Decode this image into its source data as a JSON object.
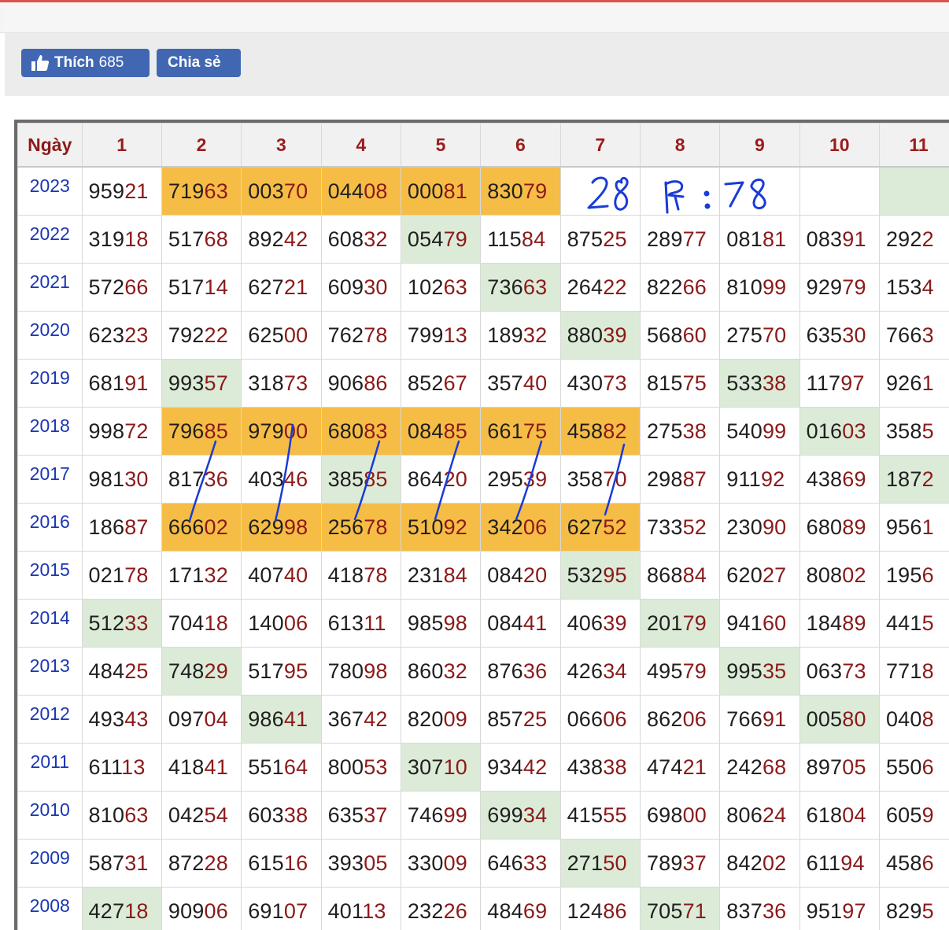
{
  "share": {
    "like_label": "Thích",
    "like_count": "685",
    "share_label": "Chia sẻ",
    "like_icon": "thumbs-up-icon"
  },
  "table": {
    "columns": [
      "Ngày",
      "1",
      "2",
      "3",
      "4",
      "5",
      "6",
      "7",
      "8",
      "9",
      "10",
      "11"
    ],
    "rows": [
      {
        "year": "2023",
        "cells": [
          [
            "959",
            "21",
            ""
          ],
          [
            "719",
            "63",
            "o"
          ],
          [
            "003",
            "70",
            "o"
          ],
          [
            "044",
            "08",
            "o"
          ],
          [
            "000",
            "81",
            "o"
          ],
          [
            "830",
            "79",
            "o"
          ],
          [
            "",
            "",
            ""
          ],
          [
            "",
            "",
            ""
          ],
          [
            "",
            "",
            ""
          ],
          [
            "",
            "",
            ""
          ],
          [
            "",
            "",
            "g"
          ]
        ]
      },
      {
        "year": "2022",
        "cells": [
          [
            "319",
            "18",
            ""
          ],
          [
            "517",
            "68",
            ""
          ],
          [
            "892",
            "42",
            ""
          ],
          [
            "608",
            "32",
            ""
          ],
          [
            "054",
            "79",
            "g"
          ],
          [
            "115",
            "84",
            ""
          ],
          [
            "875",
            "25",
            ""
          ],
          [
            "289",
            "77",
            ""
          ],
          [
            "081",
            "81",
            ""
          ],
          [
            "083",
            "91",
            ""
          ],
          [
            "292",
            "2",
            ""
          ]
        ]
      },
      {
        "year": "2021",
        "cells": [
          [
            "572",
            "66",
            ""
          ],
          [
            "517",
            "14",
            ""
          ],
          [
            "627",
            "21",
            ""
          ],
          [
            "609",
            "30",
            ""
          ],
          [
            "102",
            "63",
            ""
          ],
          [
            "736",
            "63",
            "g"
          ],
          [
            "264",
            "22",
            ""
          ],
          [
            "822",
            "66",
            ""
          ],
          [
            "810",
            "99",
            ""
          ],
          [
            "929",
            "79",
            ""
          ],
          [
            "153",
            "4",
            ""
          ]
        ]
      },
      {
        "year": "2020",
        "cells": [
          [
            "623",
            "23",
            ""
          ],
          [
            "792",
            "22",
            ""
          ],
          [
            "625",
            "00",
            ""
          ],
          [
            "762",
            "78",
            ""
          ],
          [
            "799",
            "13",
            ""
          ],
          [
            "189",
            "32",
            ""
          ],
          [
            "880",
            "39",
            "g"
          ],
          [
            "568",
            "60",
            ""
          ],
          [
            "275",
            "70",
            ""
          ],
          [
            "635",
            "30",
            ""
          ],
          [
            "766",
            "3",
            ""
          ]
        ]
      },
      {
        "year": "2019",
        "cells": [
          [
            "681",
            "91",
            ""
          ],
          [
            "993",
            "57",
            "g"
          ],
          [
            "318",
            "73",
            ""
          ],
          [
            "906",
            "86",
            ""
          ],
          [
            "852",
            "67",
            ""
          ],
          [
            "357",
            "40",
            ""
          ],
          [
            "430",
            "73",
            ""
          ],
          [
            "815",
            "75",
            ""
          ],
          [
            "533",
            "38",
            "g"
          ],
          [
            "117",
            "97",
            ""
          ],
          [
            "926",
            "1",
            ""
          ]
        ]
      },
      {
        "year": "2018",
        "cells": [
          [
            "998",
            "72",
            ""
          ],
          [
            "796",
            "85",
            "o"
          ],
          [
            "979",
            "00",
            "o"
          ],
          [
            "680",
            "83",
            "o"
          ],
          [
            "084",
            "85",
            "o"
          ],
          [
            "661",
            "75",
            "o"
          ],
          [
            "458",
            "82",
            "o"
          ],
          [
            "275",
            "38",
            ""
          ],
          [
            "540",
            "99",
            ""
          ],
          [
            "016",
            "03",
            "g"
          ],
          [
            "358",
            "5",
            ""
          ]
        ]
      },
      {
        "year": "2017",
        "cells": [
          [
            "981",
            "30",
            ""
          ],
          [
            "817",
            "36",
            ""
          ],
          [
            "403",
            "46",
            ""
          ],
          [
            "385",
            "85",
            "g"
          ],
          [
            "864",
            "20",
            ""
          ],
          [
            "295",
            "39",
            ""
          ],
          [
            "358",
            "70",
            ""
          ],
          [
            "298",
            "87",
            ""
          ],
          [
            "911",
            "92",
            ""
          ],
          [
            "438",
            "69",
            ""
          ],
          [
            "187",
            "2",
            "g"
          ]
        ]
      },
      {
        "year": "2016",
        "cells": [
          [
            "186",
            "87",
            ""
          ],
          [
            "666",
            "02",
            "o"
          ],
          [
            "629",
            "98",
            "o"
          ],
          [
            "256",
            "78",
            "o"
          ],
          [
            "510",
            "92",
            "o"
          ],
          [
            "342",
            "06",
            "o"
          ],
          [
            "627",
            "52",
            "o"
          ],
          [
            "733",
            "52",
            ""
          ],
          [
            "230",
            "90",
            ""
          ],
          [
            "680",
            "89",
            ""
          ],
          [
            "956",
            "1",
            ""
          ]
        ]
      },
      {
        "year": "2015",
        "cells": [
          [
            "021",
            "78",
            ""
          ],
          [
            "171",
            "32",
            ""
          ],
          [
            "407",
            "40",
            ""
          ],
          [
            "418",
            "78",
            ""
          ],
          [
            "231",
            "84",
            ""
          ],
          [
            "084",
            "20",
            ""
          ],
          [
            "532",
            "95",
            "g"
          ],
          [
            "868",
            "84",
            ""
          ],
          [
            "620",
            "27",
            ""
          ],
          [
            "808",
            "02",
            ""
          ],
          [
            "195",
            "6",
            ""
          ]
        ]
      },
      {
        "year": "2014",
        "cells": [
          [
            "512",
            "33",
            "g"
          ],
          [
            "704",
            "18",
            ""
          ],
          [
            "140",
            "06",
            ""
          ],
          [
            "613",
            "11",
            ""
          ],
          [
            "985",
            "98",
            ""
          ],
          [
            "084",
            "41",
            ""
          ],
          [
            "406",
            "39",
            ""
          ],
          [
            "201",
            "79",
            "g"
          ],
          [
            "941",
            "60",
            ""
          ],
          [
            "184",
            "89",
            ""
          ],
          [
            "441",
            "5",
            ""
          ]
        ]
      },
      {
        "year": "2013",
        "cells": [
          [
            "484",
            "25",
            ""
          ],
          [
            "748",
            "29",
            "g"
          ],
          [
            "517",
            "95",
            ""
          ],
          [
            "780",
            "98",
            ""
          ],
          [
            "860",
            "32",
            ""
          ],
          [
            "876",
            "36",
            ""
          ],
          [
            "426",
            "34",
            ""
          ],
          [
            "495",
            "79",
            ""
          ],
          [
            "995",
            "35",
            "g"
          ],
          [
            "063",
            "73",
            ""
          ],
          [
            "771",
            "8",
            ""
          ]
        ]
      },
      {
        "year": "2012",
        "cells": [
          [
            "493",
            "43",
            ""
          ],
          [
            "097",
            "04",
            ""
          ],
          [
            "986",
            "41",
            "g"
          ],
          [
            "367",
            "42",
            ""
          ],
          [
            "820",
            "09",
            ""
          ],
          [
            "857",
            "25",
            ""
          ],
          [
            "066",
            "06",
            ""
          ],
          [
            "862",
            "06",
            ""
          ],
          [
            "766",
            "91",
            ""
          ],
          [
            "005",
            "80",
            "g"
          ],
          [
            "040",
            "8",
            ""
          ]
        ]
      },
      {
        "year": "2011",
        "cells": [
          [
            "611",
            "13",
            ""
          ],
          [
            "418",
            "41",
            ""
          ],
          [
            "551",
            "64",
            ""
          ],
          [
            "800",
            "53",
            ""
          ],
          [
            "307",
            "10",
            "g"
          ],
          [
            "934",
            "42",
            ""
          ],
          [
            "438",
            "38",
            ""
          ],
          [
            "474",
            "21",
            ""
          ],
          [
            "242",
            "68",
            ""
          ],
          [
            "897",
            "05",
            ""
          ],
          [
            "550",
            "6",
            ""
          ]
        ]
      },
      {
        "year": "2010",
        "cells": [
          [
            "810",
            "63",
            ""
          ],
          [
            "042",
            "54",
            ""
          ],
          [
            "603",
            "38",
            ""
          ],
          [
            "635",
            "37",
            ""
          ],
          [
            "746",
            "99",
            ""
          ],
          [
            "699",
            "34",
            "g"
          ],
          [
            "415",
            "55",
            ""
          ],
          [
            "698",
            "00",
            ""
          ],
          [
            "806",
            "24",
            ""
          ],
          [
            "618",
            "04",
            ""
          ],
          [
            "605",
            "9",
            ""
          ]
        ]
      },
      {
        "year": "2009",
        "cells": [
          [
            "587",
            "31",
            ""
          ],
          [
            "872",
            "28",
            ""
          ],
          [
            "615",
            "16",
            ""
          ],
          [
            "393",
            "05",
            ""
          ],
          [
            "330",
            "09",
            ""
          ],
          [
            "646",
            "33",
            ""
          ],
          [
            "271",
            "50",
            "g"
          ],
          [
            "789",
            "37",
            ""
          ],
          [
            "842",
            "02",
            ""
          ],
          [
            "611",
            "94",
            ""
          ],
          [
            "458",
            "6",
            ""
          ]
        ]
      },
      {
        "year": "2008",
        "cells": [
          [
            "427",
            "18",
            "g"
          ],
          [
            "909",
            "06",
            ""
          ],
          [
            "691",
            "07",
            ""
          ],
          [
            "401",
            "13",
            ""
          ],
          [
            "232",
            "26",
            ""
          ],
          [
            "484",
            "69",
            ""
          ],
          [
            "124",
            "86",
            ""
          ],
          [
            "705",
            "71",
            "g"
          ],
          [
            "837",
            "36",
            ""
          ],
          [
            "951",
            "97",
            ""
          ],
          [
            "829",
            "5",
            ""
          ]
        ]
      }
    ]
  },
  "handwriting": {
    "note": "28 5: 78",
    "ink_color": "#1a3bd6"
  },
  "colors": {
    "highlight_orange": "#f5bd45",
    "highlight_green": "#dcebd7",
    "year_link": "#1a36b4",
    "tail_digits": "#8b1a1a",
    "facebook_blue": "#4267b2"
  }
}
